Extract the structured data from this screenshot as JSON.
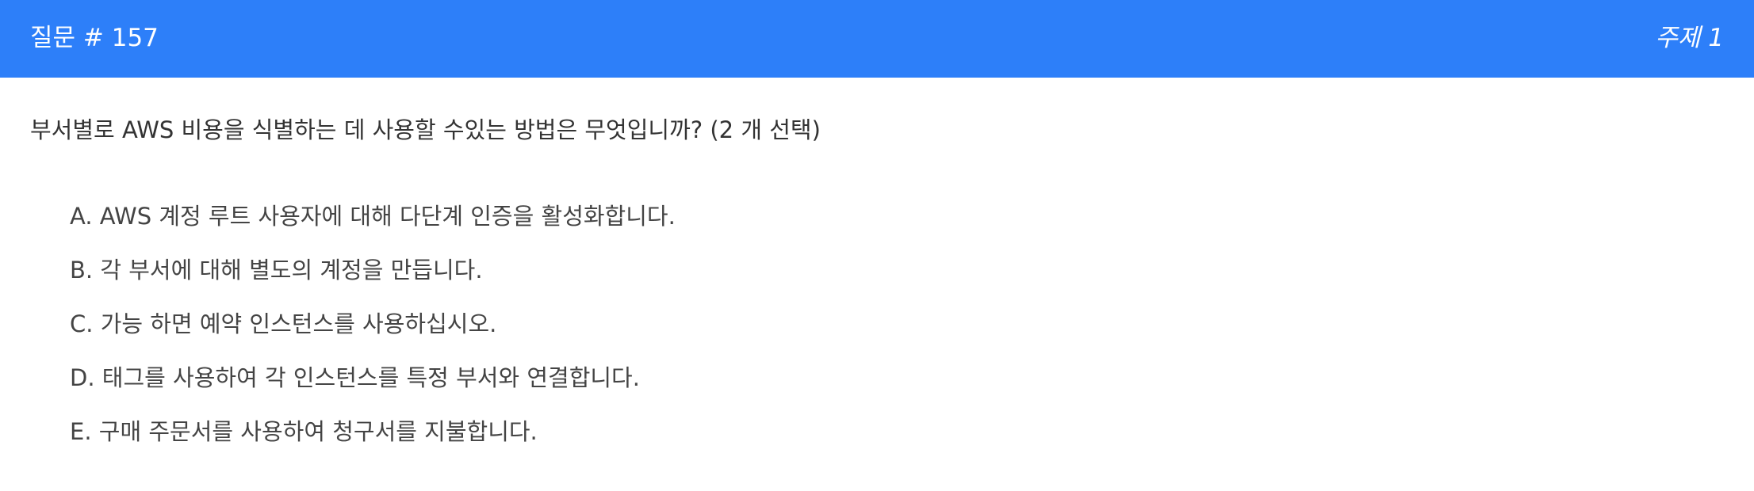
{
  "header": {
    "question_number": "질문 # 157",
    "topic": "주제 1"
  },
  "question": {
    "text": "부서별로 AWS 비용을 식별하는 데 사용할 수있는 방법은 무엇입니까? (2 개 선택)"
  },
  "choices": [
    {
      "letter": "A.",
      "text": "AWS 계정 루트 사용자에 대해 다단계 인증을 활성화합니다."
    },
    {
      "letter": "B.",
      "text": "각 부서에 대해 별도의 계정을 만듭니다."
    },
    {
      "letter": "C.",
      "text": "가능 하면 예약 인스턴스를 사용하십시오."
    },
    {
      "letter": "D.",
      "text": "태그를 사용하여 각 인스턴스를 특정 부서와 연결합니다."
    },
    {
      "letter": "E.",
      "text": "구매 주문서를 사용하여 청구서를 지불합니다."
    }
  ],
  "colors": {
    "header_bg": "#2d7ff9",
    "header_text": "#ffffff",
    "body_text": "#333333"
  }
}
